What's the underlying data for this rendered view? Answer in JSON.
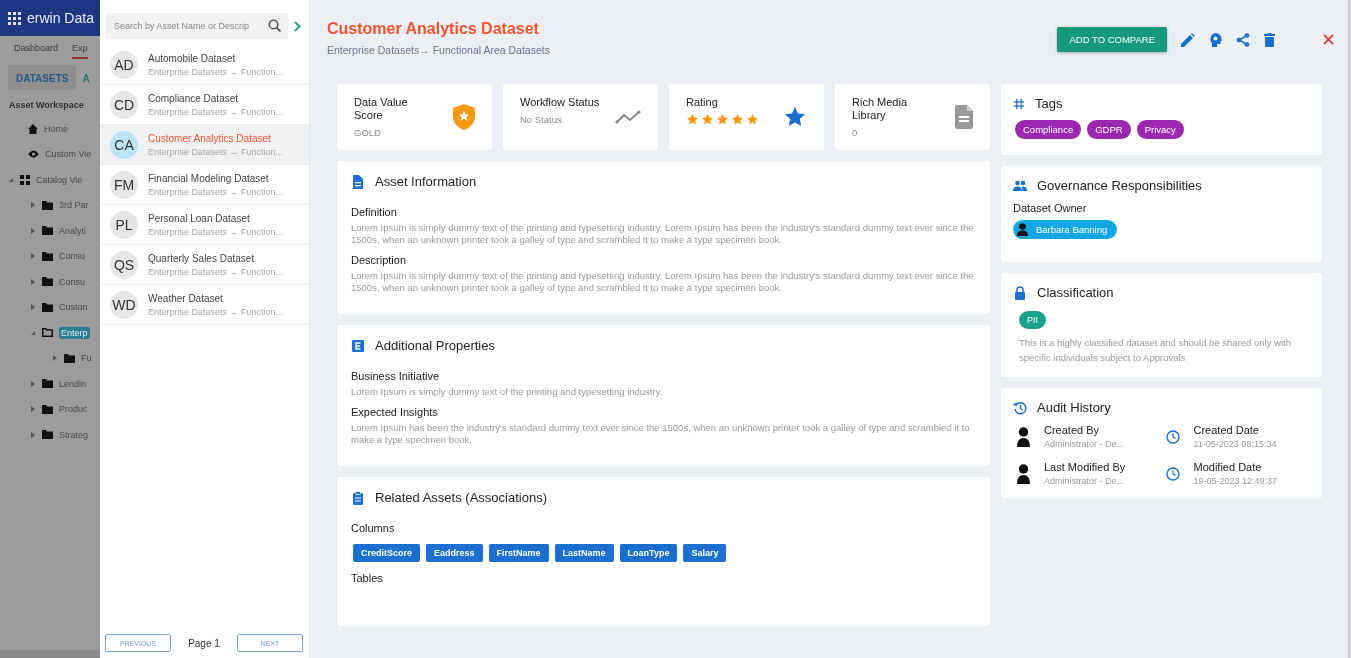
{
  "app_background": {
    "brand": "erwin Data",
    "nav_tabs": [
      {
        "label": "Dashboard",
        "selected": false
      },
      {
        "label": "Exp",
        "selected": true
      }
    ],
    "sub_tabs": [
      {
        "label": "DATASETS",
        "selected": true
      },
      {
        "label": "A",
        "selected": false
      }
    ],
    "workspace_title": "Asset Workspace",
    "tree": [
      {
        "kind": "home",
        "label": "Home",
        "selected": false
      },
      {
        "kind": "view",
        "label": "Custom Vie",
        "selected": false
      },
      {
        "kind": "catalog",
        "label": "Catalog Vie",
        "selected": false,
        "expanded": true,
        "children": [
          {
            "kind": "folder",
            "label": "3rd Par",
            "selected": false,
            "expanded": false
          },
          {
            "kind": "folder",
            "label": "Analyti",
            "selected": false,
            "expanded": false
          },
          {
            "kind": "folder",
            "label": "Consu",
            "selected": false,
            "expanded": false
          },
          {
            "kind": "folder",
            "label": "Consu",
            "selected": false,
            "expanded": false
          },
          {
            "kind": "folder",
            "label": "Custon",
            "selected": false,
            "expanded": false
          },
          {
            "kind": "folder",
            "label": "Enterp",
            "selected": true,
            "expanded": true,
            "children": [
              {
                "kind": "folder",
                "label": "Fu",
                "selected": false,
                "expanded": false
              }
            ]
          },
          {
            "kind": "folder",
            "label": "Lendin",
            "selected": false,
            "expanded": false
          },
          {
            "kind": "folder",
            "label": "Produc",
            "selected": false,
            "expanded": false
          },
          {
            "kind": "folder",
            "label": "Strateg",
            "selected": false,
            "expanded": false
          }
        ]
      }
    ]
  },
  "asset_list": {
    "search": {
      "placeholder": "Search by Asset Name or Descrip"
    },
    "items": [
      {
        "initials": "AD",
        "name": "Automobile Dataset",
        "path": "Enterprise Datasets → Function...",
        "selected": false
      },
      {
        "initials": "CD",
        "name": "Compliance Dataset",
        "path": "Enterprise Datasets → Function...",
        "selected": false
      },
      {
        "initials": "CA",
        "name": "Customer Analytics Dataset",
        "path": "Enterprise Datasets → Function...",
        "selected": true
      },
      {
        "initials": "FM",
        "name": "Financial Modeling Dataset",
        "path": "Enterprise Datasets → Function...",
        "selected": false
      },
      {
        "initials": "PL",
        "name": "Personal Loan Dataset",
        "path": "Enterprise Datasets → Function...",
        "selected": false
      },
      {
        "initials": "QS",
        "name": "Quarterly Sales Dataset",
        "path": "Enterprise Datasets → Function...",
        "selected": false
      },
      {
        "initials": "WD",
        "name": "Weather Dataset",
        "path": "Enterprise Datasets → Function...",
        "selected": false
      }
    ],
    "pagination": {
      "previous": "PREVIOUS",
      "page": "Page 1",
      "next": "NEXT"
    }
  },
  "detail": {
    "title": "Customer Analytics Dataset",
    "breadcrumb": "Enterprise Datasets→ Functional Area Datasets",
    "compare_button": "ADD TO COMPARE",
    "stats": [
      {
        "kind": "score",
        "label": "Data Value Score",
        "value": "GOLD"
      },
      {
        "kind": "workflow",
        "label": "Workflow Status",
        "value": "No Status"
      },
      {
        "kind": "rating",
        "label": "Rating",
        "stars": 5
      },
      {
        "kind": "media",
        "label": "Rich Media Library",
        "value": "0"
      }
    ],
    "asset_information": {
      "title": "Asset Information",
      "fields": [
        {
          "label": "Definition",
          "text": "Lorem Ipsum is simply dummy text of the printing and typesetting industry. Lorem Ipsum has been the industry's standard dummy text ever since the 1500s, when an unknown printer took a galley of type and scrambled it to make a type specimen book."
        },
        {
          "label": "Description",
          "text": "Lorem Ipsum is simply dummy text of the printing and typesetting industry. Lorem Ipsum has been the industry's standard dummy text ever since the 1500s, when an unknown printer took a galley of type and scrambled it to make a type specimen book."
        }
      ]
    },
    "additional_properties": {
      "title": "Additional Properties",
      "fields": [
        {
          "label": "Business Initiative",
          "text": "Lorem Ipsum is simply dummy text of the printing and typesetting industry."
        },
        {
          "label": "Expected Insights",
          "text": "Lorem Ipsum has been the industry's standard dummy text ever since the 1500s, when an unknown printer took a galley of type and scrambled it to make a type specimen book."
        }
      ]
    },
    "related_assets": {
      "title": "Related Assets (Associations)",
      "columns_label": "Columns",
      "columns": [
        "CreditScore",
        "Eaddress",
        "FirstName",
        "LastName",
        "LoanType",
        "Salary"
      ],
      "tables_label": "Tables"
    },
    "tags": {
      "title": "Tags",
      "items": [
        "Compliance",
        "GDPR",
        "Privacy"
      ]
    },
    "governance": {
      "title": "Governance Responsibilities",
      "owner_label": "Dataset Owner",
      "owner": "Barbara Banning"
    },
    "classification": {
      "title": "Classification",
      "badge": "PII",
      "note": "This is a highly classified dataset and should be shared only with specific individuals subject to Approvals"
    },
    "audit": {
      "title": "Audit History",
      "entries": [
        {
          "kind": "person",
          "label": "Created By",
          "value": "Administrator - De..."
        },
        {
          "kind": "date",
          "label": "Created Date",
          "value": "11-05-2023 08:15:34"
        },
        {
          "kind": "person",
          "label": "Last Modified By",
          "value": "Administrator - De..."
        },
        {
          "kind": "date",
          "label": "Modified Date",
          "value": "19-05-2023 12:49:37"
        }
      ]
    }
  }
}
